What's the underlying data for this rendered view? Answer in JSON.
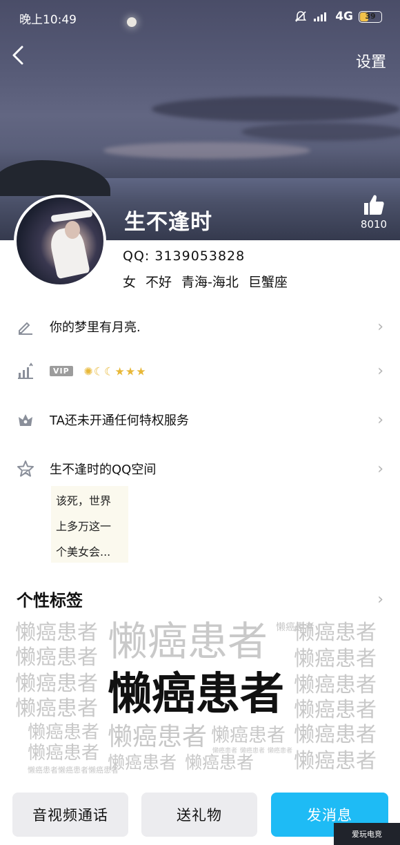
{
  "status_bar": {
    "time": "晚上10:49",
    "network": "4G",
    "battery": "39",
    "battery_level": 0.39
  },
  "header": {
    "back_icon": "chevron-left-icon",
    "settings_label": "设置",
    "like_icon": "thumbs-up-icon",
    "like_count": "8010"
  },
  "profile": {
    "nickname": "生不逢时",
    "qq_label": "QQ: 3139053828",
    "gender": "女",
    "age": "不好",
    "location": "青海-海北",
    "zodiac": "巨蟹座"
  },
  "rows": {
    "signature": {
      "icon": "pencil-icon",
      "text": "你的梦里有月亮."
    },
    "level": {
      "icon": "level-chart-icon",
      "vip_tag": "VIP",
      "level_icons": "sun-moon-moon-star-star-star"
    },
    "privilege": {
      "icon": "crown-icon",
      "text": "TA还未开通任何特权服务"
    },
    "qzone": {
      "icon": "star-icon",
      "text": "生不逢时的QQ空间"
    }
  },
  "qzone_preview": [
    "该死，世界",
    "上多万这一",
    "个美女会..."
  ],
  "tags": {
    "title": "个性标签",
    "word": "懒癌患者"
  },
  "bottom": {
    "call_label": "音视频通话",
    "gift_label": "送礼物",
    "message_label": "发消息"
  },
  "watermark": "爱玩电竞",
  "colors": {
    "accent": "#1ebbf5",
    "chevron": "#b3b3b3",
    "tag_light": "#c8c8c8"
  }
}
